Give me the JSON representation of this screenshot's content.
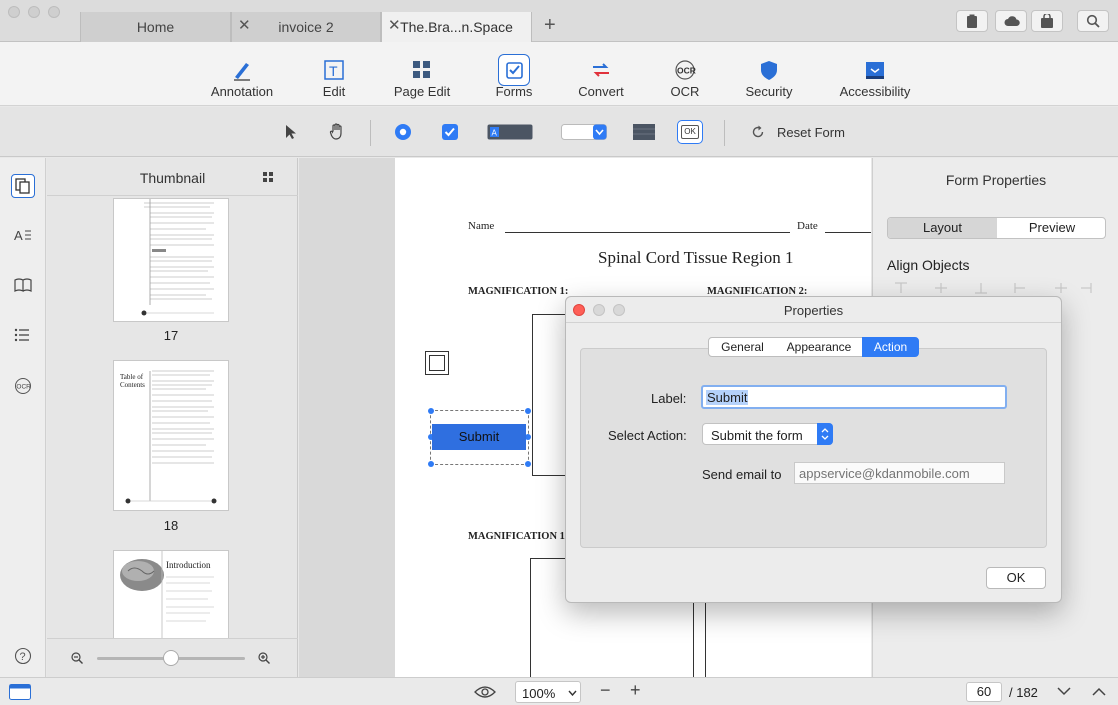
{
  "tabs": [
    {
      "label": "Home"
    },
    {
      "label": "invoice 2"
    },
    {
      "label": "The.Bra...n.Space",
      "active": true
    }
  ],
  "toolbar": {
    "items": [
      {
        "label": "Annotation",
        "icon": "pen-icon"
      },
      {
        "label": "Edit",
        "icon": "text-edit-icon"
      },
      {
        "label": "Page Edit",
        "icon": "grid-icon"
      },
      {
        "label": "Forms",
        "icon": "checkbox-icon",
        "selected": true
      },
      {
        "label": "Convert",
        "icon": "convert-icon"
      },
      {
        "label": "OCR",
        "icon": "ocr-icon"
      },
      {
        "label": "Security",
        "icon": "shield-icon"
      },
      {
        "label": "Accessibility",
        "icon": "accessibility-icon"
      }
    ]
  },
  "forms_toolbar": {
    "reset_label": "Reset Form",
    "ok_icon_label": "OK"
  },
  "thumbnail_panel": {
    "title": "Thumbnail",
    "pages": [
      {
        "number": "17"
      },
      {
        "number": "18",
        "heading": "Table of Contents"
      },
      {
        "number": "",
        "heading": "Introduction"
      }
    ]
  },
  "document": {
    "name_label": "Name",
    "date_label": "Date",
    "title": "Spinal Cord Tissue Region 1",
    "mag1_label": "MAGNIFICATION 1:",
    "mag2_label": "MAGNIFICATION 2:",
    "mag_lower_label": "MAGNIFICATION 1",
    "submit_button": "Submit"
  },
  "form_properties": {
    "title": "Form Properties",
    "tabs": [
      "Layout",
      "Preview"
    ],
    "align_label": "Align Objects"
  },
  "dialog": {
    "title": "Properties",
    "tabs": [
      "General",
      "Appearance",
      "Action"
    ],
    "active_tab": "Action",
    "label_caption": "Label:",
    "label_value": "Submit",
    "action_caption": "Select Action:",
    "action_value": "Submit the form",
    "email_caption": "Send email to",
    "email_placeholder": "appservice@kdanmobile.com",
    "ok_label": "OK"
  },
  "statusbar": {
    "zoom": "100%",
    "current_page": "60",
    "total_pages": "/ 182"
  },
  "colors": {
    "accent": "#2f7bf5",
    "security": "#2a6fd6",
    "convert_red": "#e0323c"
  }
}
